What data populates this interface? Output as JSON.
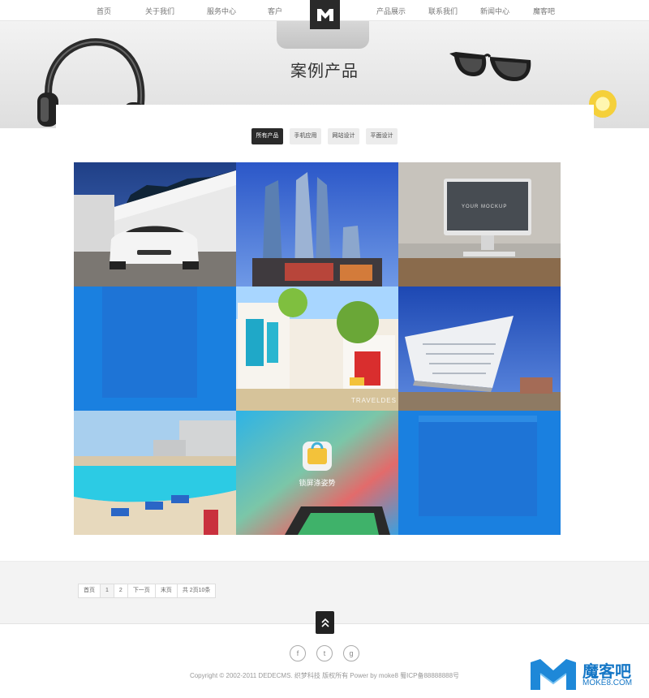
{
  "nav": {
    "left_items": [
      "首页",
      "关于我们",
      "服务中心",
      "客户"
    ],
    "right_items": [
      "产品展示",
      "联系我们",
      "新闻中心",
      "魔客吧"
    ]
  },
  "logo": {
    "icon": "m-logo-icon"
  },
  "banner": {
    "title": "案例产品"
  },
  "tabs": [
    {
      "label": "所有产品",
      "active": true
    },
    {
      "label": "手机应用",
      "active": false
    },
    {
      "label": "网站设计",
      "active": false
    },
    {
      "label": "平面设计",
      "active": false
    }
  ],
  "gallery": [
    {
      "subject": "white sports car"
    },
    {
      "subject": "glass skyscrapers"
    },
    {
      "subject": "YOUR MOCKUP",
      "caption": "YOUR    MOCKUP"
    },
    {
      "subject": "blue placeholder"
    },
    {
      "subject": "colorful street",
      "caption": "TRAVELDES"
    },
    {
      "subject": "white building"
    },
    {
      "subject": "seaside pool"
    },
    {
      "subject": "lock screen app",
      "caption": "锁屏涤姿势"
    },
    {
      "subject": "blue placeholder"
    }
  ],
  "pager": [
    "首页",
    "1",
    "2",
    "下一页",
    "末页",
    "共 2页10条"
  ],
  "back_to_top": {
    "icon": "double-chevron-up-icon"
  },
  "social": [
    {
      "icon": "facebook-icon",
      "glyph": "f"
    },
    {
      "icon": "twitter-icon",
      "glyph": "t"
    },
    {
      "icon": "google-icon",
      "glyph": "g"
    }
  ],
  "footer": {
    "copyright": "Copyright © 2002-2011 DEDECMS. 织梦科技 版权所有 Power by moke8  蜀ICP备88888888号"
  },
  "watermark": {
    "brand": "魔客吧",
    "domain": "MOKE8.COM"
  },
  "colors": {
    "accent": "#2a2a2a",
    "placeholder_blue": "#1a80e0",
    "watermark": "#1577c6"
  }
}
